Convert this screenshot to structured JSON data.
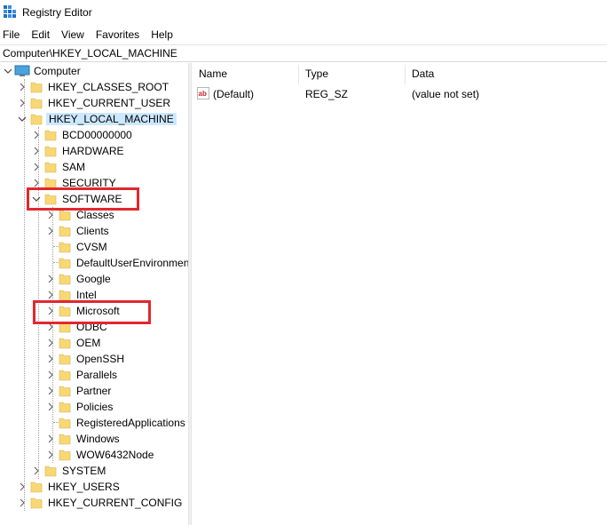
{
  "window": {
    "title": "Registry Editor"
  },
  "menu": [
    "File",
    "Edit",
    "View",
    "Favorites",
    "Help"
  ],
  "address": "Computer\\HKEY_LOCAL_MACHINE",
  "tree": {
    "root": "Computer",
    "hives": {
      "classes_root": "HKEY_CLASSES_ROOT",
      "current_user": "HKEY_CURRENT_USER",
      "local_machine": "HKEY_LOCAL_MACHINE",
      "users": "HKEY_USERS",
      "current_config": "HKEY_CURRENT_CONFIG"
    },
    "hklm_children": {
      "bcd": "BCD00000000",
      "hardware": "HARDWARE",
      "sam": "SAM",
      "security": "SECURITY",
      "software": "SOFTWARE",
      "system": "SYSTEM"
    },
    "software_children": [
      "Classes",
      "Clients",
      "CVSM",
      "DefaultUserEnvironmen",
      "Google",
      "Intel",
      "Microsoft",
      "ODBC",
      "OEM",
      "OpenSSH",
      "Parallels",
      "Partner",
      "Policies",
      "RegisteredApplications",
      "Windows",
      "WOW6432Node"
    ]
  },
  "list": {
    "columns": {
      "name": "Name",
      "type": "Type",
      "data": "Data"
    },
    "rows": [
      {
        "name": "(Default)",
        "type": "REG_SZ",
        "data": "(value not set)",
        "icon": "string-value-icon"
      }
    ]
  },
  "colors": {
    "selection": "#cce8ff",
    "highlight_annotation": "#e0282e",
    "folder": "#f8d775"
  }
}
